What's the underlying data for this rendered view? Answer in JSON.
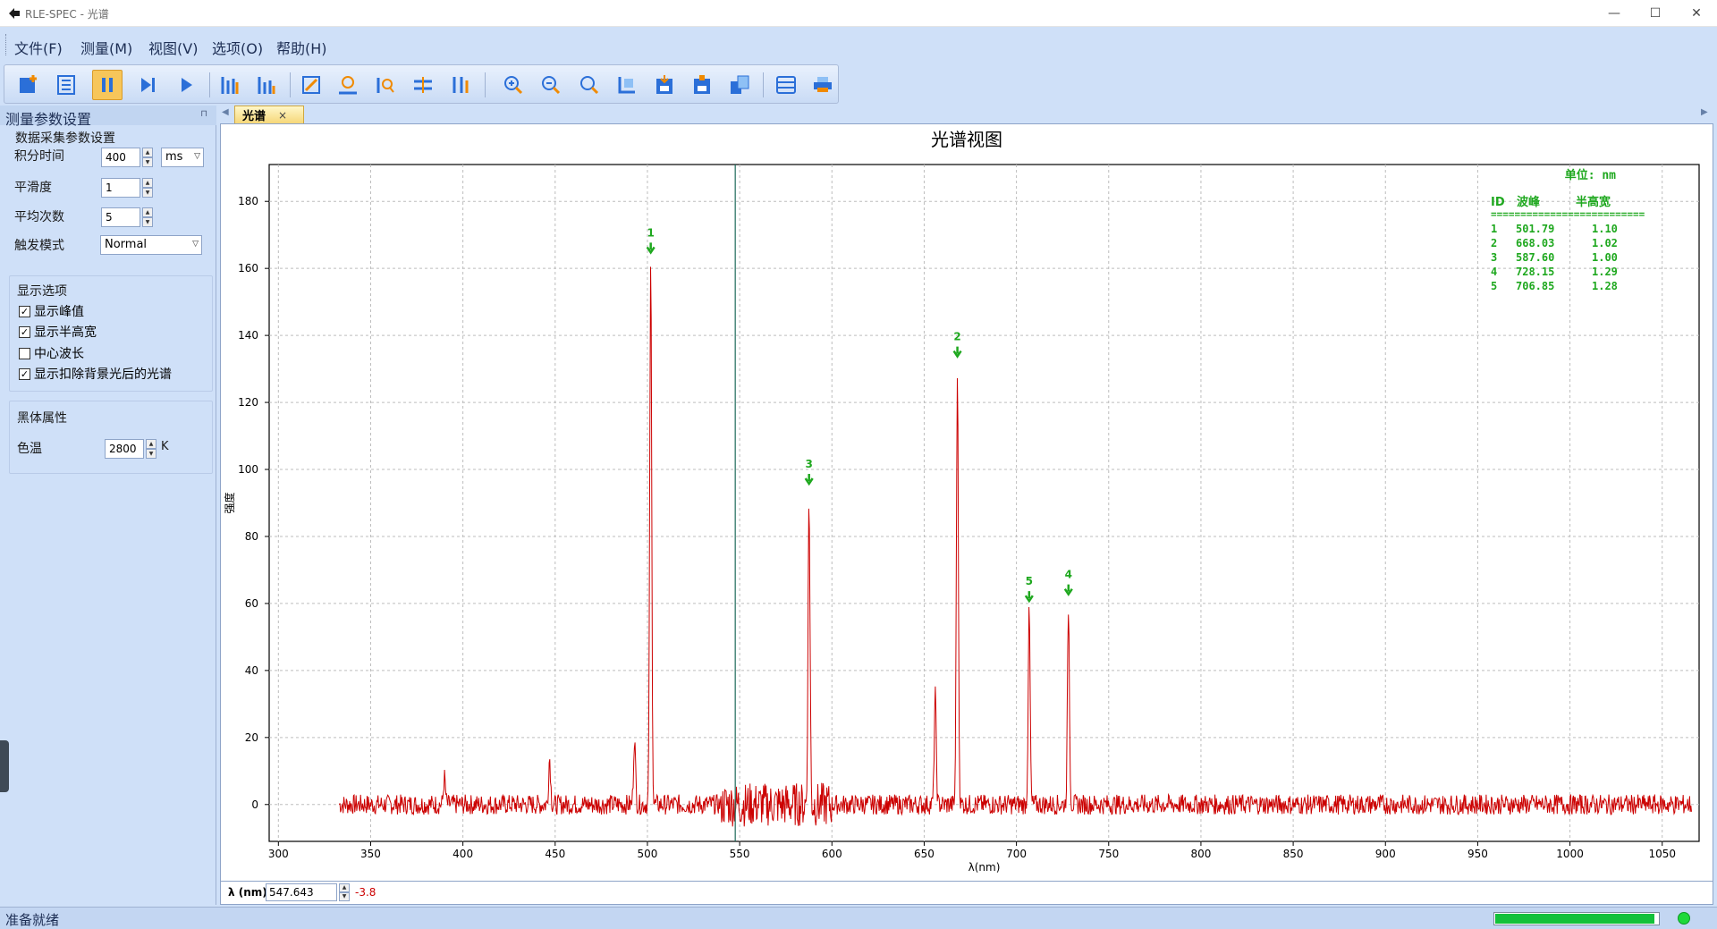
{
  "window": {
    "title": "RLE-SPEC - 光谱"
  },
  "menu": [
    "文件(F)",
    "测量(M)",
    "视图(V)",
    "选项(O)",
    "帮助(H)"
  ],
  "toolbar": {
    "buttons": [
      {
        "icon": "add-icon",
        "active": false
      },
      {
        "icon": "list-icon",
        "active": false
      },
      {
        "icon": "pause-icon",
        "active": true
      },
      {
        "icon": "step-icon",
        "active": false
      },
      {
        "icon": "play-icon",
        "active": false
      },
      {
        "icon": "bars-icon",
        "active": false
      },
      {
        "icon": "bars-down-icon",
        "active": false
      },
      {
        "icon": "chart-edit-icon",
        "active": false
      },
      {
        "icon": "peak-icon",
        "active": false
      },
      {
        "icon": "peak-search-icon",
        "active": false
      },
      {
        "icon": "baseline-icon",
        "active": false
      },
      {
        "icon": "markers-icon",
        "active": false
      },
      {
        "icon": "zoom-in-icon",
        "active": false
      },
      {
        "icon": "zoom-out-icon",
        "active": false
      },
      {
        "icon": "zoom-icon",
        "active": false
      },
      {
        "icon": "fit-icon",
        "active": false
      },
      {
        "icon": "save-icon",
        "active": false
      },
      {
        "icon": "save-as-icon",
        "active": false
      },
      {
        "icon": "copy-icon",
        "active": false
      },
      {
        "icon": "table-icon",
        "active": false
      },
      {
        "icon": "print-icon",
        "active": false
      }
    ]
  },
  "panel": {
    "title": "测量参数设置",
    "acq_title": "数据采集参数设置",
    "integration_label": "积分时间",
    "integration_value": "400",
    "integration_unit": "ms",
    "smoothing_label": "平滑度",
    "smoothing_value": "1",
    "average_label": "平均次数",
    "average_value": "5",
    "trigger_label": "触发模式",
    "trigger_value": "Normal",
    "display_title": "显示选项",
    "options": [
      {
        "label": "显示峰值",
        "checked": true
      },
      {
        "label": "显示半高宽",
        "checked": true
      },
      {
        "label": "中心波长",
        "checked": false
      },
      {
        "label": "显示扣除背景光后的光谱",
        "checked": true
      }
    ],
    "blackbody_title": "黑体属性",
    "color_temp_label": "色温",
    "color_temp_value": "2800",
    "color_temp_unit": "K"
  },
  "doc_tab": {
    "label": "光谱",
    "close": "×"
  },
  "chart_data": {
    "type": "line",
    "title": "光谱视图",
    "xlabel": "λ(nm)",
    "ylabel": "强度",
    "xlim": [
      295,
      1070
    ],
    "ylim": [
      -11,
      191
    ],
    "xticks": [
      300,
      350,
      400,
      450,
      500,
      550,
      600,
      650,
      700,
      750,
      800,
      850,
      900,
      950,
      1000,
      1050
    ],
    "yticks": [
      0,
      20,
      40,
      60,
      80,
      100,
      120,
      140,
      160,
      180
    ],
    "grid": true,
    "cursor_x": 547.6,
    "noise_amplitude": 3,
    "x_start": 333,
    "x_end": 1066,
    "peaks": [
      {
        "x": 390,
        "y": 8
      },
      {
        "x": 447,
        "y": 14
      },
      {
        "x": 493,
        "y": 20
      },
      {
        "x": 501.8,
        "y": 161
      },
      {
        "x": 587.6,
        "y": 92
      },
      {
        "x": 656,
        "y": 33
      },
      {
        "x": 668,
        "y": 130
      },
      {
        "x": 706.9,
        "y": 57
      },
      {
        "x": 728.2,
        "y": 59
      }
    ],
    "peak_labels": [
      {
        "id": "1",
        "x": 501.8,
        "y": 161
      },
      {
        "id": "2",
        "x": 668.0,
        "y": 130
      },
      {
        "id": "3",
        "x": 587.6,
        "y": 92
      },
      {
        "id": "4",
        "x": 728.2,
        "y": 59
      },
      {
        "id": "5",
        "x": 706.9,
        "y": 57
      }
    ],
    "peak_table": {
      "unit_label": "单位: nm",
      "headers": [
        "ID",
        "波峰",
        "半高宽"
      ],
      "divider": "==========================",
      "rows": [
        [
          "1",
          "501.79",
          "1.10"
        ],
        [
          "2",
          "668.03",
          "1.02"
        ],
        [
          "3",
          "587.60",
          "1.00"
        ],
        [
          "4",
          "728.15",
          "1.29"
        ],
        [
          "5",
          "706.85",
          "1.28"
        ]
      ]
    },
    "colors": {
      "line": "#cc0000",
      "peak": "#1fa81f",
      "cursor": "#1f6a5a",
      "grid": "#bdbdbd"
    }
  },
  "cursor": {
    "label": "λ (nm)",
    "value": "547.643",
    "intensity": "-3.8"
  },
  "status": {
    "text": "准备就绪",
    "progress": 0.98
  }
}
